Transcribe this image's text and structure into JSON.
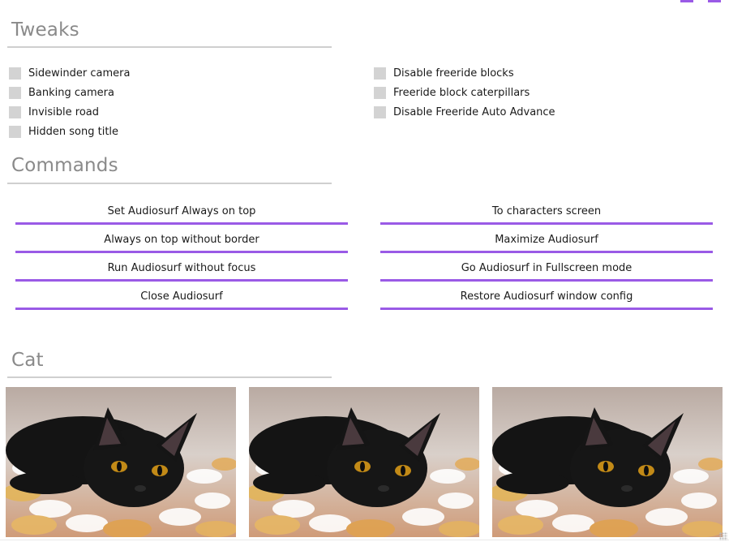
{
  "tweaks": {
    "title": "Tweaks",
    "left": [
      {
        "label": "Sidewinder camera"
      },
      {
        "label": "Banking camera"
      },
      {
        "label": "Invisible road"
      },
      {
        "label": "Hidden song title"
      }
    ],
    "right": [
      {
        "label": "Disable freeride blocks"
      },
      {
        "label": "Freeride block caterpillars"
      },
      {
        "label": "Disable Freeride Auto Advance"
      }
    ]
  },
  "commands": {
    "title": "Commands",
    "left": [
      {
        "label": "Set Audiosurf Always on top"
      },
      {
        "label": "Always on top without border"
      },
      {
        "label": "Run Audiosurf without focus"
      },
      {
        "label": "Close Audiosurf"
      }
    ],
    "right": [
      {
        "label": "To characters screen"
      },
      {
        "label": "Maximize Audiosurf"
      },
      {
        "label": "Go Audiosurf in Fullscreen mode"
      },
      {
        "label": "Restore Audiosurf window config"
      }
    ]
  },
  "cat": {
    "title": "Cat",
    "images": [
      {
        "icon": "black-cat-image"
      },
      {
        "icon": "black-cat-image"
      },
      {
        "icon": "black-cat-image"
      }
    ]
  },
  "colors": {
    "accent": "#9a5ae6",
    "checkbox": "#d3d3d3",
    "section_title": "#8a8a8a",
    "rule": "#cfcfcf"
  }
}
